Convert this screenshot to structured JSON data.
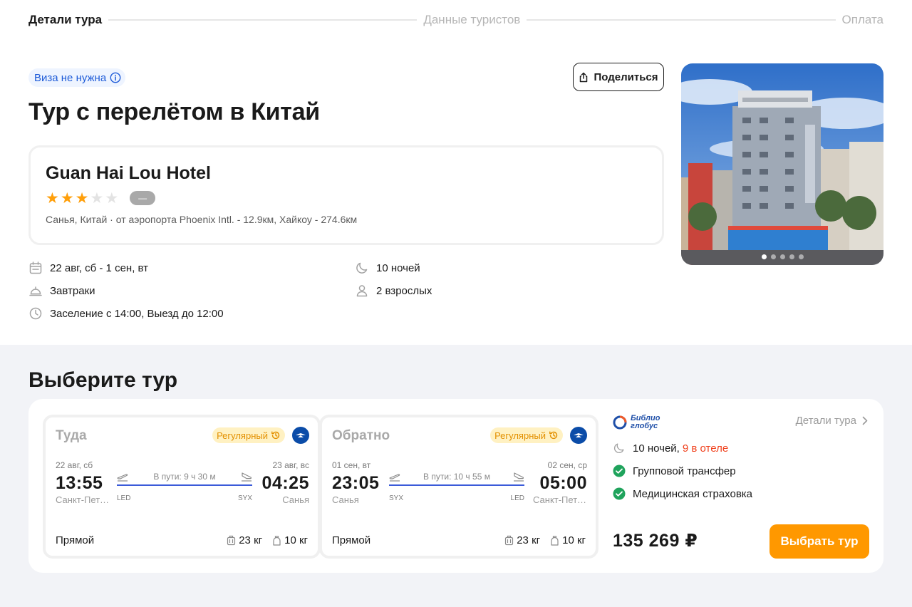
{
  "stepper": {
    "step1": "Детали тура",
    "step2": "Данные туристов",
    "step3": "Оплата"
  },
  "header": {
    "visa_badge": "Виза не нужна",
    "share_label": "Поделиться",
    "title": "Тур с перелётом в Китай"
  },
  "hotel": {
    "name": "Guan Hai Lou Hotel",
    "stars": 3,
    "max_stars": 5,
    "rating_badge": "—",
    "location": "Санья, Китай · от аэропорта Phoenix Intl. - 12.9км, Хайкоу - 274.6км",
    "photo_slides": 5,
    "photo_active_slide": 1
  },
  "details": {
    "dates": "22 авг, сб - 1 сен, вт",
    "nights": "10 ночей",
    "meals": "Завтраки",
    "guests": "2 взрослых",
    "checkin": "Заселение с 14:00, Выезд до 12:00"
  },
  "choose": {
    "title": "Выберите тур",
    "outbound": {
      "direction": "Туда",
      "type": "Регулярный",
      "dep_date": "22 авг, сб",
      "dep_time": "13:55",
      "dep_city": "Санкт-Петербург",
      "duration": "В пути: 9 ч 30 м",
      "dep_code": "LED",
      "arr_code": "SYX",
      "arr_date": "23 авг, вс",
      "arr_time": "04:25",
      "arr_city": "Санья",
      "kind": "Прямой",
      "baggage": "23 кг",
      "hand_luggage": "10 кг"
    },
    "return": {
      "direction": "Обратно",
      "type": "Регулярный",
      "dep_date": "01 сен, вт",
      "dep_time": "23:05",
      "dep_city": "Санья",
      "duration": "В пути: 10 ч 55 м",
      "dep_code": "SYX",
      "arr_code": "LED",
      "arr_date": "02 сен, ср",
      "arr_time": "05:00",
      "arr_city": "Санкт-Петербург",
      "kind": "Прямой",
      "baggage": "23 кг",
      "hand_luggage": "10 кг"
    },
    "operator_logo_line1": "Библио",
    "operator_logo_line2": "глобус",
    "details_link": "Детали тура",
    "nights_label": "10 ночей,",
    "nights_in_hotel": "9 в отеле",
    "transfer": "Групповой трансфер",
    "insurance": "Медицинская страховка",
    "price": "135 269 ₽",
    "select_label": "Выбрать тур"
  },
  "colors": {
    "accent": "#ff9800",
    "star": "#ff9f0a",
    "link_blue": "#1e5bd8",
    "check_green": "#1fa35c",
    "route_line": "#3b5bd9",
    "highlight_red": "#f0401c"
  }
}
